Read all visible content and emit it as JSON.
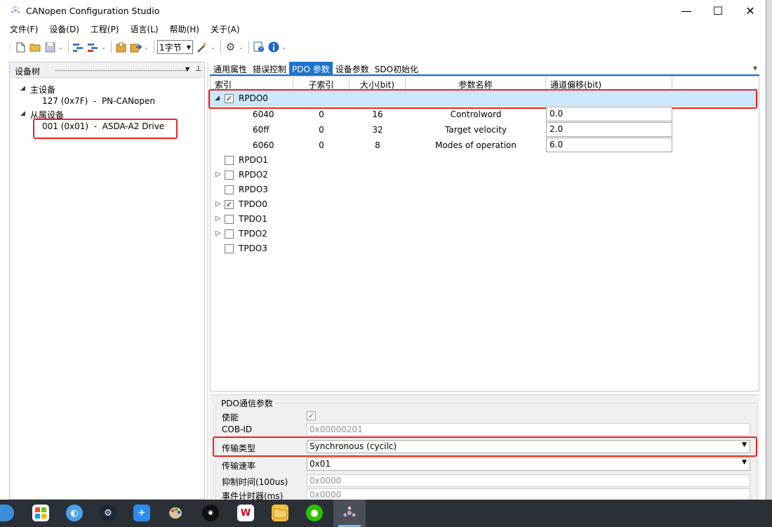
{
  "window": {
    "title": "CANopen Configuration Studio",
    "controls": [
      "—",
      "☐",
      "✕"
    ]
  },
  "menu": [
    "文件(F)",
    "设备(D)",
    "工程(P)",
    "语言(L)",
    "帮助(H)",
    "关于(A)"
  ],
  "toolbar": {
    "byte_select": "1字节"
  },
  "device_tree": {
    "title": "设备树",
    "master_label": "主设备",
    "master_item": "127 (0x7F)  -  PN-CANopen",
    "slave_label": "从属设备",
    "slave_item": "001 (0x01)  -  ASDA-A2 Drive"
  },
  "tabs": [
    "通用属性",
    "错误控制",
    "PDO 参数",
    "设备参数",
    "SDO初始化"
  ],
  "grid": {
    "headers": [
      "索引",
      "子索引",
      "大小(bit)",
      "参数名称",
      "通道偏移(bit)"
    ],
    "rpdo0": {
      "name": "RPDO0",
      "checked": "✓"
    },
    "mappings": [
      {
        "index": "6040",
        "sub": "0",
        "size": "16",
        "name": "Controlword",
        "offset": "0.0"
      },
      {
        "index": "60ff",
        "sub": "0",
        "size": "32",
        "name": "Target velocity",
        "offset": "2.0"
      },
      {
        "index": "6060",
        "sub": "0",
        "size": "8",
        "name": "Modes of operation",
        "offset": "6.0"
      }
    ],
    "pdos": [
      {
        "name": "RPDO1",
        "check": ""
      },
      {
        "name": "RPDO2",
        "check": ""
      },
      {
        "name": "RPDO3",
        "check": ""
      },
      {
        "name": "TPDO0",
        "check": "✓"
      },
      {
        "name": "TPDO1",
        "check": ""
      },
      {
        "name": "TPDO2",
        "check": ""
      },
      {
        "name": "TPDO3",
        "check": ""
      }
    ]
  },
  "comm": {
    "title": "PDO通信参数",
    "enable_label": "使能",
    "enable_check": "✓",
    "cobid_label": "COB-ID",
    "cobid_value": "0x00000201",
    "transmit_type_label": "传输类型",
    "transmit_type_value": "Synchronous (cycilc)",
    "transmit_rate_label": "传输速率",
    "transmit_rate_value": "0x01",
    "inhibit_label": "抑制时间(100us)",
    "inhibit_value": "0x0000",
    "event_label": "事件计时器(ms)",
    "event_value": "0x0000"
  },
  "colors": {
    "accent": "#1f73c9",
    "highlight": "#e8241c",
    "selected_row": "#cce8ff"
  }
}
